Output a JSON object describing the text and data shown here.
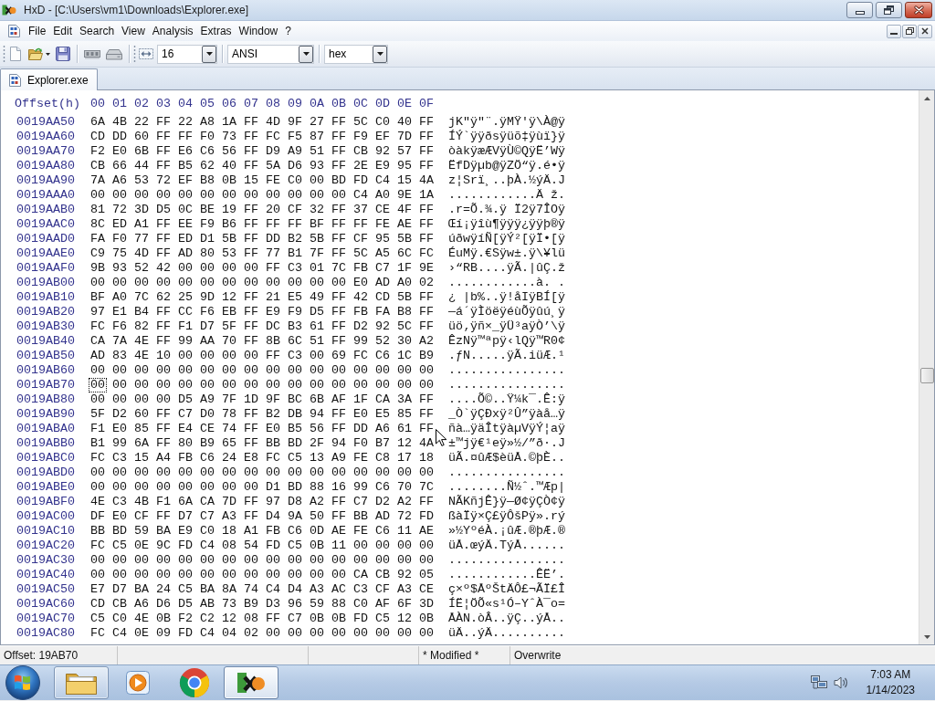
{
  "window": {
    "title": "HxD - [C:\\Users\\vm1\\Downloads\\Explorer.exe]"
  },
  "menu": [
    "File",
    "Edit",
    "Search",
    "View",
    "Analysis",
    "Extras",
    "Window",
    "?"
  ],
  "toolbar": {
    "button_groups": [
      [
        {
          "kind": "new"
        },
        {
          "kind": "open"
        },
        {
          "kind": "save"
        }
      ],
      [
        {
          "kind": "memory"
        },
        {
          "kind": "disk"
        }
      ]
    ],
    "dropdowns": [
      "16",
      "ANSI",
      "hex"
    ]
  },
  "tabs": [
    {
      "label": "Explorer.exe",
      "selected": true
    }
  ],
  "editor": {
    "header": {
      "label": "Offset(h)",
      "columns": [
        "00",
        "01",
        "02",
        "03",
        "04",
        "05",
        "06",
        "07",
        "08",
        "09",
        "0A",
        "0B",
        "0C",
        "0D",
        "0E",
        "0F"
      ]
    },
    "rows": [
      {
        "offset": "0019AA50",
        "bytes": [
          "6A",
          "4B",
          "22",
          "FF",
          "22",
          "A8",
          "1A",
          "FF",
          "4D",
          "9F",
          "27",
          "FF",
          "5C",
          "C0",
          "40",
          "FF"
        ],
        "text": "jK\"ÿ\"¨.ÿMŸ'ÿ\\À@ÿ",
        "caret": false
      },
      {
        "offset": "0019AA60",
        "bytes": [
          "CD",
          "DD",
          "60",
          "FF",
          "FF",
          "F0",
          "73",
          "FF",
          "FC",
          "F5",
          "87",
          "FF",
          "F9",
          "EF",
          "7D",
          "FF"
        ],
        "text": "ÍÝ`ÿÿðsÿüõ‡ÿùï}ÿ",
        "caret": false
      },
      {
        "offset": "0019AA70",
        "bytes": [
          "F2",
          "E0",
          "6B",
          "FF",
          "E6",
          "C6",
          "56",
          "FF",
          "D9",
          "A9",
          "51",
          "FF",
          "CB",
          "92",
          "57",
          "FF"
        ],
        "text": "òàkÿæÆVÿÙ©QÿË’Wÿ",
        "caret": false
      },
      {
        "offset": "0019AA80",
        "bytes": [
          "CB",
          "66",
          "44",
          "FF",
          "B5",
          "62",
          "40",
          "FF",
          "5A",
          "D6",
          "93",
          "FF",
          "2E",
          "E9",
          "95",
          "FF"
        ],
        "text": "ËfDÿµb@ÿZÖ“ÿ.é•ÿ",
        "caret": false
      },
      {
        "offset": "0019AA90",
        "bytes": [
          "7A",
          "A6",
          "53",
          "72",
          "EF",
          "B8",
          "0B",
          "15",
          "FE",
          "C0",
          "00",
          "BD",
          "FD",
          "C4",
          "15",
          "4A"
        ],
        "text": "z¦Srï¸..þÀ.½ýÄ.J",
        "caret": false
      },
      {
        "offset": "0019AAA0",
        "bytes": [
          "00",
          "00",
          "00",
          "00",
          "00",
          "00",
          "00",
          "00",
          "00",
          "00",
          "00",
          "00",
          "C4",
          "A0",
          "9E",
          "1A"
        ],
        "text": "............Ä ž.",
        "caret": false
      },
      {
        "offset": "0019AAB0",
        "bytes": [
          "81",
          "72",
          "3D",
          "D5",
          "0C",
          "BE",
          "19",
          "FF",
          "20",
          "CF",
          "32",
          "FF",
          "37",
          "CE",
          "4F",
          "FF"
        ],
        "text": ".r=Õ.¾.ÿ Ï2ÿ7ÎOÿ",
        "caret": false
      },
      {
        "offset": "0019AAC0",
        "bytes": [
          "8C",
          "ED",
          "A1",
          "FF",
          "EE",
          "F9",
          "B6",
          "FF",
          "FF",
          "FF",
          "BF",
          "FF",
          "FF",
          "FE",
          "AE",
          "FF"
        ],
        "text": "Œí¡ÿîù¶ÿÿÿ¿ÿÿþ®ÿ",
        "caret": false
      },
      {
        "offset": "0019AAD0",
        "bytes": [
          "FA",
          "F0",
          "77",
          "FF",
          "ED",
          "D1",
          "5B",
          "FF",
          "DD",
          "B2",
          "5B",
          "FF",
          "CF",
          "95",
          "5B",
          "FF"
        ],
        "text": "úðwÿíÑ[ÿÝ²[ÿÏ•[ÿ",
        "caret": false
      },
      {
        "offset": "0019AAE0",
        "bytes": [
          "C9",
          "75",
          "4D",
          "FF",
          "AD",
          "80",
          "53",
          "FF",
          "77",
          "B1",
          "7F",
          "FF",
          "5C",
          "A5",
          "6C",
          "FC"
        ],
        "text": "ÉuMÿ.€Sÿw±.ÿ\\¥lü",
        "caret": false
      },
      {
        "offset": "0019AAF0",
        "bytes": [
          "9B",
          "93",
          "52",
          "42",
          "00",
          "00",
          "00",
          "00",
          "FF",
          "C3",
          "01",
          "7C",
          "FB",
          "C7",
          "1F",
          "9E"
        ],
        "text": "›“RB....ÿÃ.|ûÇ.ž",
        "caret": false
      },
      {
        "offset": "0019AB00",
        "bytes": [
          "00",
          "00",
          "00",
          "00",
          "00",
          "00",
          "00",
          "00",
          "00",
          "00",
          "00",
          "00",
          "E0",
          "AD",
          "A0",
          "02"
        ],
        "text": "............à. .",
        "caret": false
      },
      {
        "offset": "0019AB10",
        "bytes": [
          "BF",
          "A0",
          "7C",
          "62",
          "25",
          "9D",
          "12",
          "FF",
          "21",
          "E5",
          "49",
          "FF",
          "42",
          "CD",
          "5B",
          "FF"
        ],
        "text": "¿ |b%..ÿ!åIÿBÍ[ÿ",
        "caret": false
      },
      {
        "offset": "0019AB20",
        "bytes": [
          "97",
          "E1",
          "B4",
          "FF",
          "CC",
          "F6",
          "EB",
          "FF",
          "E9",
          "F9",
          "D5",
          "FF",
          "FB",
          "FA",
          "B8",
          "FF"
        ],
        "text": "—á´ÿÌöëÿéùÕÿûú¸ÿ",
        "caret": false
      },
      {
        "offset": "0019AB30",
        "bytes": [
          "FC",
          "F6",
          "82",
          "FF",
          "F1",
          "D7",
          "5F",
          "FF",
          "DC",
          "B3",
          "61",
          "FF",
          "D2",
          "92",
          "5C",
          "FF"
        ],
        "text": "üö‚ÿñ×_ÿÜ³aÿÒ’\\ÿ",
        "caret": false
      },
      {
        "offset": "0019AB40",
        "bytes": [
          "CA",
          "7A",
          "4E",
          "FF",
          "99",
          "AA",
          "70",
          "FF",
          "8B",
          "6C",
          "51",
          "FF",
          "99",
          "52",
          "30",
          "A2"
        ],
        "text": "ÊzNÿ™ªpÿ‹lQÿ™R0¢",
        "caret": false
      },
      {
        "offset": "0019AB50",
        "bytes": [
          "AD",
          "83",
          "4E",
          "10",
          "00",
          "00",
          "00",
          "00",
          "FF",
          "C3",
          "00",
          "69",
          "FC",
          "C6",
          "1C",
          "B9"
        ],
        "text": ".ƒN.....ÿÃ.iüÆ.¹",
        "caret": false
      },
      {
        "offset": "0019AB60",
        "bytes": [
          "00",
          "00",
          "00",
          "00",
          "00",
          "00",
          "00",
          "00",
          "00",
          "00",
          "00",
          "00",
          "00",
          "00",
          "00",
          "00"
        ],
        "text": "................",
        "caret": false
      },
      {
        "offset": "0019AB70",
        "bytes": [
          "00",
          "00",
          "00",
          "00",
          "00",
          "00",
          "00",
          "00",
          "00",
          "00",
          "00",
          "00",
          "00",
          "00",
          "00",
          "00"
        ],
        "text": "................",
        "caret": true
      },
      {
        "offset": "0019AB80",
        "bytes": [
          "00",
          "00",
          "00",
          "00",
          "D5",
          "A9",
          "7F",
          "1D",
          "9F",
          "BC",
          "6B",
          "AF",
          "1F",
          "CA",
          "3A",
          "FF"
        ],
        "text": "....Õ©..Ÿ¼k¯.Ê:ÿ",
        "caret": false
      },
      {
        "offset": "0019AB90",
        "bytes": [
          "5F",
          "D2",
          "60",
          "FF",
          "C7",
          "D0",
          "78",
          "FF",
          "B2",
          "DB",
          "94",
          "FF",
          "E0",
          "E5",
          "85",
          "FF"
        ],
        "text": "_Ò`ÿÇÐxÿ²Û”ÿàå…ÿ",
        "caret": false
      },
      {
        "offset": "0019ABA0",
        "bytes": [
          "F1",
          "E0",
          "85",
          "FF",
          "E4",
          "CE",
          "74",
          "FF",
          "E0",
          "B5",
          "56",
          "FF",
          "DD",
          "A6",
          "61",
          "FF"
        ],
        "text": "ñà…ÿäÎtÿàµVÿÝ¦aÿ",
        "caret": false
      },
      {
        "offset": "0019ABB0",
        "bytes": [
          "B1",
          "99",
          "6A",
          "FF",
          "80",
          "B9",
          "65",
          "FF",
          "BB",
          "BD",
          "2F",
          "94",
          "F0",
          "B7",
          "12",
          "4A"
        ],
        "text": "±™jÿ€¹eÿ»½/”ð·.J",
        "caret": false
      },
      {
        "offset": "0019ABC0",
        "bytes": [
          "FC",
          "C3",
          "15",
          "A4",
          "FB",
          "C6",
          "24",
          "E8",
          "FC",
          "C5",
          "13",
          "A9",
          "FE",
          "C8",
          "17",
          "18"
        ],
        "text": "üÃ.¤ûÆ$èüÅ.©þÈ..",
        "caret": false
      },
      {
        "offset": "0019ABD0",
        "bytes": [
          "00",
          "00",
          "00",
          "00",
          "00",
          "00",
          "00",
          "00",
          "00",
          "00",
          "00",
          "00",
          "00",
          "00",
          "00",
          "00"
        ],
        "text": "................",
        "caret": false
      },
      {
        "offset": "0019ABE0",
        "bytes": [
          "00",
          "00",
          "00",
          "00",
          "00",
          "00",
          "00",
          "00",
          "D1",
          "BD",
          "88",
          "16",
          "99",
          "C6",
          "70",
          "7C"
        ],
        "text": "........Ñ½ˆ.™Æp|",
        "caret": false
      },
      {
        "offset": "0019ABF0",
        "bytes": [
          "4E",
          "C3",
          "4B",
          "F1",
          "6A",
          "CA",
          "7D",
          "FF",
          "97",
          "D8",
          "A2",
          "FF",
          "C7",
          "D2",
          "A2",
          "FF"
        ],
        "text": "NÃKñjÊ}ÿ—Ø¢ÿÇÒ¢ÿ",
        "caret": false
      },
      {
        "offset": "0019AC00",
        "bytes": [
          "DF",
          "E0",
          "CF",
          "FF",
          "D7",
          "C7",
          "A3",
          "FF",
          "D4",
          "9A",
          "50",
          "FF",
          "BB",
          "AD",
          "72",
          "FD"
        ],
        "text": "ßàÏÿ×Ç£ÿÔšPÿ».rý",
        "caret": false
      },
      {
        "offset": "0019AC10",
        "bytes": [
          "BB",
          "BD",
          "59",
          "BA",
          "E9",
          "C0",
          "18",
          "A1",
          "FB",
          "C6",
          "0D",
          "AE",
          "FE",
          "C6",
          "11",
          "AE"
        ],
        "text": "»½YºéÀ.¡ûÆ.®þÆ.®",
        "caret": false
      },
      {
        "offset": "0019AC20",
        "bytes": [
          "FC",
          "C5",
          "0E",
          "9C",
          "FD",
          "C4",
          "08",
          "54",
          "FD",
          "C5",
          "0B",
          "11",
          "00",
          "00",
          "00",
          "00"
        ],
        "text": "üÅ.œýÄ.TýÅ......",
        "caret": false
      },
      {
        "offset": "0019AC30",
        "bytes": [
          "00",
          "00",
          "00",
          "00",
          "00",
          "00",
          "00",
          "00",
          "00",
          "00",
          "00",
          "00",
          "00",
          "00",
          "00",
          "00"
        ],
        "text": "................",
        "caret": false
      },
      {
        "offset": "0019AC40",
        "bytes": [
          "00",
          "00",
          "00",
          "00",
          "00",
          "00",
          "00",
          "00",
          "00",
          "00",
          "00",
          "00",
          "CA",
          "CB",
          "92",
          "05"
        ],
        "text": "............ÊË’.",
        "caret": false
      },
      {
        "offset": "0019AC50",
        "bytes": [
          "E7",
          "D7",
          "BA",
          "24",
          "C5",
          "BA",
          "8A",
          "74",
          "C4",
          "D4",
          "A3",
          "AC",
          "C3",
          "CF",
          "A3",
          "CE"
        ],
        "text": "ç×º$ÅºŠtÄÔ£¬ÃÏ£Î",
        "caret": false
      },
      {
        "offset": "0019AC60",
        "bytes": [
          "CD",
          "CB",
          "A6",
          "D6",
          "D5",
          "AB",
          "73",
          "B9",
          "D3",
          "96",
          "59",
          "88",
          "C0",
          "AF",
          "6F",
          "3D"
        ],
        "text": "ÍË¦ÖÕ«s¹Ó–YˆÀ¯o=",
        "caret": false
      },
      {
        "offset": "0019AC70",
        "bytes": [
          "C5",
          "C0",
          "4E",
          "0B",
          "F2",
          "C2",
          "12",
          "08",
          "FF",
          "C7",
          "0B",
          "0B",
          "FD",
          "C5",
          "12",
          "0B"
        ],
        "text": "ÅÀN.òÂ..ÿÇ..ýÅ..",
        "caret": false
      },
      {
        "offset": "0019AC80",
        "bytes": [
          "FC",
          "C4",
          "0E",
          "09",
          "FD",
          "C4",
          "04",
          "02",
          "00",
          "00",
          "00",
          "00",
          "00",
          "00",
          "00",
          "00"
        ],
        "text": "üÄ..ýÄ..........",
        "caret": false
      }
    ]
  },
  "status_bar": {
    "offset": "Offset: 19AB70",
    "modified": "* Modified *",
    "mode": "Overwrite"
  },
  "taskbar": {
    "items": [
      {
        "kind": "explorer",
        "running": true,
        "selected": false
      },
      {
        "kind": "media_player",
        "running": false,
        "selected": false
      },
      {
        "kind": "browser",
        "running": false,
        "selected": false
      },
      {
        "kind": "hex_editor",
        "running": true,
        "selected": true
      }
    ],
    "clock": {
      "time": "7:03 AM",
      "date": "1/14/2023"
    }
  }
}
